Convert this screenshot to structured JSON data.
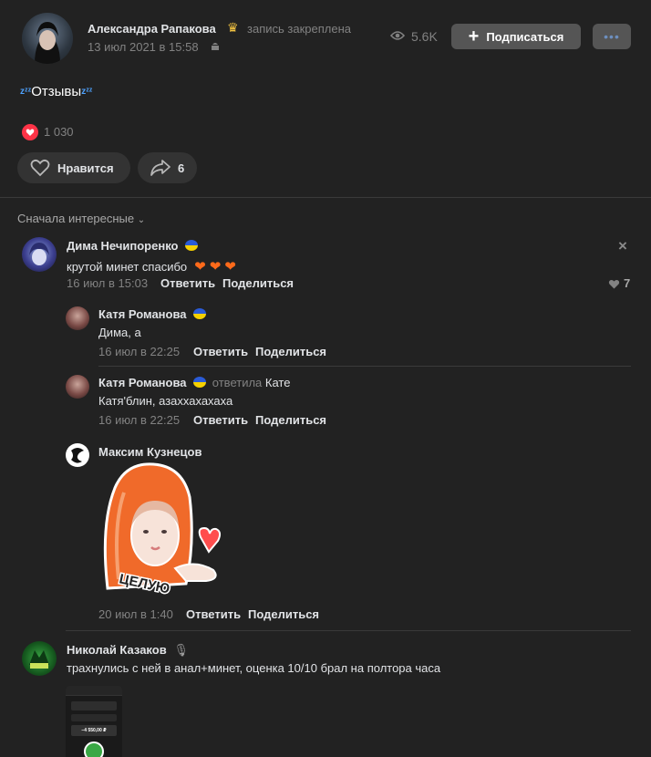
{
  "post": {
    "author": "Александра Рапакова",
    "crown_icon": "crown-icon",
    "pinned_text": "запись закреплена",
    "date": "13 июл 2021 в 15:58",
    "views": "5.6K",
    "subscribe_label": "Подписаться",
    "body_text": "Отзывы",
    "likes_count": "1 030",
    "like_button_label": "Нравится",
    "share_count": "6"
  },
  "comments": {
    "sort_label": "Сначала интересные",
    "reply_label": "Ответить",
    "share_label": "Поделиться",
    "items": [
      {
        "author": "Дима Нечипоренко",
        "text": "крутой минет спасибо",
        "date": "16 июл в 15:03",
        "likes": "7"
      },
      {
        "author": "Катя Романова",
        "text": "Дима, а",
        "date": "16 июл в 22:25"
      },
      {
        "author": "Катя Романова",
        "reply_to_prefix": "ответила",
        "reply_to": "Кате",
        "text": "Катя'блин, азаххахахаха",
        "date": "16 июл в 22:25"
      },
      {
        "author": "Максим Кузнецов",
        "sticker_text": "ЦЕЛУЮ",
        "date": "20 июл в 1:40"
      },
      {
        "author": "Николай Казаков",
        "text": "трахнулись с ней в анал+минет, оценка 10/10 брал на полтора часа",
        "screenshot_amount": "−4 550,00 ₽"
      }
    ]
  },
  "colors": {
    "background": "#222222",
    "accent_heart": "#ff3347",
    "flag_blue": "#2a5bd7",
    "flag_yellow": "#f5d000"
  }
}
